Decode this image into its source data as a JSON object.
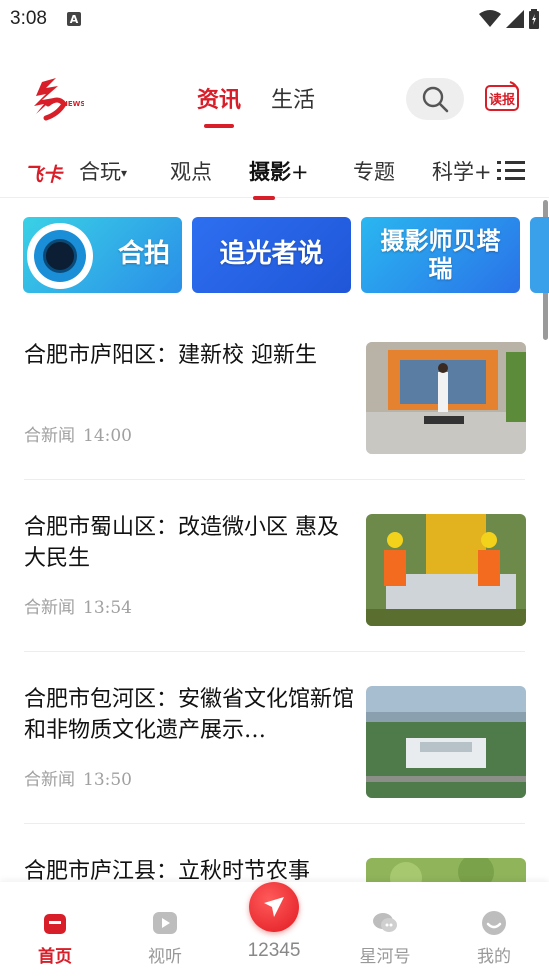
{
  "status_bar": {
    "time": "3:08",
    "a_badge": "A"
  },
  "header": {
    "tabs": [
      {
        "label": "资讯",
        "active": true
      },
      {
        "label": "生活",
        "active": false
      }
    ],
    "read_label": "读报",
    "logo_text": "NEWS"
  },
  "channels": {
    "feika": "飞卡",
    "items": [
      "合玩",
      "观点",
      "摄影",
      "专题",
      "科学"
    ],
    "active": "摄影"
  },
  "banners": [
    "合拍",
    "追光者说",
    "摄影师贝塔瑞"
  ],
  "news": [
    {
      "title": "合肥市庐阳区：建新校  迎新生",
      "source": "合新闻",
      "time": "14:00"
    },
    {
      "title": "合肥市蜀山区：改造微小区  惠及大民生",
      "source": "合新闻",
      "time": "13:54"
    },
    {
      "title": "合肥市包河区：安徽省文化馆新馆和非物质文化遗产展示…",
      "source": "合新闻",
      "time": "13:50"
    },
    {
      "title": "合肥市庐江县：立秋时节农事",
      "source": "",
      "time": ""
    }
  ],
  "bottom_nav": {
    "home": "首页",
    "video": "视听",
    "hotline": "12345",
    "xinghe": "星河号",
    "mine": "我的"
  },
  "colors": {
    "accent": "#d81e29",
    "muted": "#a0a0a0"
  }
}
